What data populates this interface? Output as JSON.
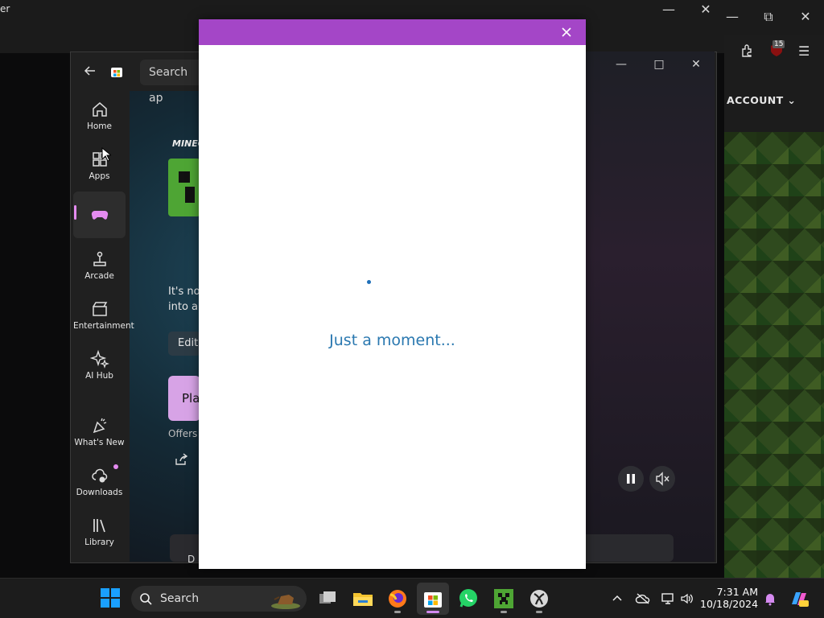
{
  "background_window": {
    "title_fragment": "er",
    "browser_badge_count": "15",
    "account_label": "ACCOUNT"
  },
  "store": {
    "search_placeholder": "Search ap",
    "nav": [
      {
        "label": "Home",
        "icon": "home-icon"
      },
      {
        "label": "Apps",
        "icon": "apps-icon"
      },
      {
        "label": "",
        "icon": "gaming-icon"
      },
      {
        "label": "Arcade",
        "icon": "arcade-icon"
      },
      {
        "label": "Entertainment",
        "icon": "entertainment-icon"
      },
      {
        "label": "AI Hub",
        "icon": "ai-hub-icon"
      },
      {
        "label": "What's New",
        "icon": "whats-new-icon"
      },
      {
        "label": "Downloads",
        "icon": "downloads-icon"
      },
      {
        "label": "Library",
        "icon": "library-icon"
      }
    ],
    "product_title_fragment": "MINEC",
    "description_line1": "It's no",
    "description_line2": "into a",
    "edit_button": "Edit",
    "play_button": "Pla",
    "offers_text": "Offers",
    "bottom_card_text": "D"
  },
  "modal": {
    "loading_text": "Just a moment...",
    "accent_color": "#a446c7"
  },
  "taskbar": {
    "search_label": "Search",
    "time": "7:31 AM",
    "date": "10/18/2024",
    "apps": [
      "start-icon",
      "task-view-icon",
      "file-explorer-icon",
      "firefox-icon",
      "microsoft-store-icon",
      "whatsapp-icon",
      "minecraft-icon",
      "xbox-icon"
    ]
  }
}
